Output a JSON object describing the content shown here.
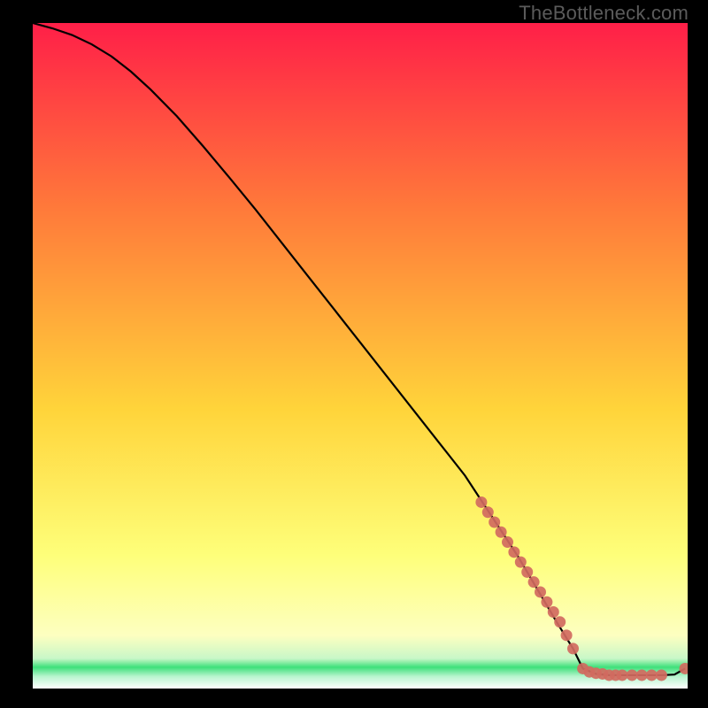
{
  "watermark": "TheBottleneck.com",
  "colors": {
    "gradient_top": "#ff1f48",
    "gradient_upper_mid": "#ff7a3a",
    "gradient_mid": "#ffd43a",
    "gradient_lower_mid": "#feff7a",
    "gradient_green_band": "#3ee07a",
    "gradient_bottom": "#ffffff",
    "curve": "#000000",
    "marker": "#d16a60",
    "background": "#000000"
  },
  "chart_data": {
    "type": "line",
    "title": "",
    "xlabel": "",
    "ylabel": "",
    "xlim": [
      0,
      100
    ],
    "ylim": [
      0,
      100
    ],
    "series": [
      {
        "name": "curve",
        "x": [
          0,
          3,
          6,
          9,
          12,
          15,
          18,
          22,
          26,
          30,
          34,
          38,
          42,
          46,
          50,
          54,
          58,
          62,
          66,
          70,
          74,
          77,
          80,
          82.5,
          84,
          86,
          88,
          90,
          92,
          94,
          96,
          98,
          99.6
        ],
        "y": [
          100,
          99.2,
          98.2,
          96.8,
          95.0,
          92.7,
          90.0,
          86.0,
          81.5,
          76.8,
          72.0,
          67.0,
          62.0,
          57.0,
          52.0,
          47.0,
          42.0,
          37.0,
          32.0,
          26.0,
          20.0,
          15.0,
          10.0,
          6.0,
          3.0,
          2.2,
          2.0,
          2.0,
          2.0,
          2.0,
          2.0,
          2.1,
          3.0
        ]
      }
    ],
    "markers": {
      "name": "highlight-points",
      "x": [
        68.5,
        69.5,
        70.5,
        71.5,
        72.5,
        73.5,
        74.5,
        75.5,
        76.5,
        77.5,
        78.5,
        79.5,
        80.5,
        81.5,
        82.5,
        84.0,
        85.0,
        86.0,
        87.0,
        88.0,
        89.0,
        90.0,
        91.5,
        93.0,
        94.5,
        96.0,
        99.6
      ],
      "y": [
        28.0,
        26.5,
        25.0,
        23.5,
        22.0,
        20.5,
        19.0,
        17.5,
        16.0,
        14.5,
        13.0,
        11.5,
        10.0,
        8.0,
        6.0,
        3.0,
        2.5,
        2.3,
        2.2,
        2.0,
        2.0,
        2.0,
        2.0,
        2.0,
        2.0,
        2.0,
        3.0
      ]
    }
  }
}
